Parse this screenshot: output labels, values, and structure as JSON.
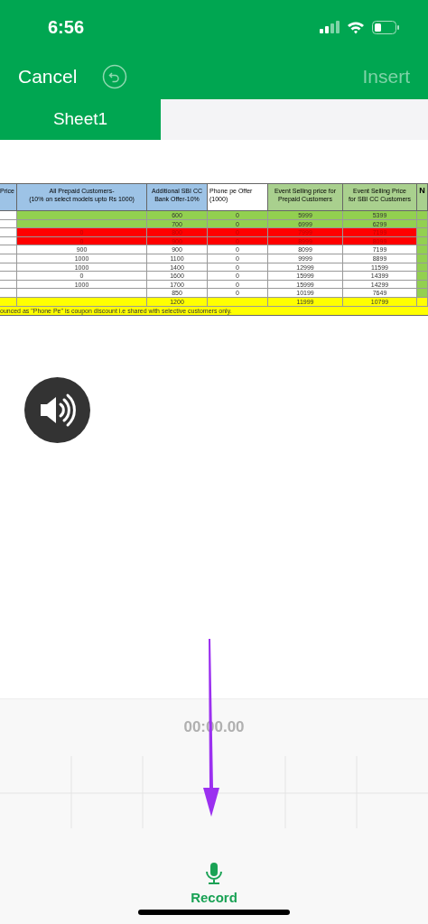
{
  "status_bar": {
    "time": "6:56"
  },
  "nav": {
    "cancel": "Cancel",
    "insert": "Insert",
    "insert_disabled": true
  },
  "tabs": [
    {
      "label": "Sheet1",
      "selected": true
    }
  ],
  "sheet": {
    "columns": [
      {
        "label": "Price",
        "color": "#9dc3e6"
      },
      {
        "label": "All Prepaid Customers-\n(10% on select models upto Rs 1000)",
        "color": "#9dc3e6"
      },
      {
        "label": "Additional SBI CC\nBank Offer-10%",
        "color": "#9dc3e6"
      },
      {
        "label": "Phone pe Offer\n(1000)",
        "color": "#ffffff"
      },
      {
        "label": "Event Selling price for\nPrepaid Customers",
        "color": "#a9d08e"
      },
      {
        "label": "Event Selling Price\nfor SBI CC Customers",
        "color": "#a9d08e"
      },
      {
        "label": "N",
        "color": "#a9d08e"
      }
    ],
    "rows": [
      {
        "kind": "green",
        "cells": [
          "",
          "",
          "600",
          "0",
          "5999",
          "5399",
          ""
        ]
      },
      {
        "kind": "green",
        "cells": [
          "",
          "",
          "700",
          "0",
          "6999",
          "6299",
          ""
        ]
      },
      {
        "kind": "red",
        "cells": [
          "",
          "0",
          "800",
          "0",
          "7999",
          "7199",
          ""
        ]
      },
      {
        "kind": "red",
        "cells": [
          "",
          "0",
          "900",
          "0",
          "8999",
          "8099",
          ""
        ]
      },
      {
        "kind": "white",
        "cells": [
          "",
          "900",
          "900",
          "0",
          "8099",
          "7199",
          ""
        ]
      },
      {
        "kind": "white",
        "cells": [
          "",
          "1000",
          "1100",
          "0",
          "9999",
          "8899",
          ""
        ]
      },
      {
        "kind": "white",
        "cells": [
          "",
          "1000",
          "1400",
          "0",
          "12999",
          "11599",
          ""
        ]
      },
      {
        "kind": "white",
        "cells": [
          "",
          "0",
          "1600",
          "0",
          "15999",
          "14399",
          ""
        ]
      },
      {
        "kind": "white",
        "cells": [
          "",
          "1000",
          "1700",
          "0",
          "15999",
          "14299",
          ""
        ]
      },
      {
        "kind": "white",
        "cells": [
          "",
          "",
          "850",
          "0",
          "10199",
          "7649",
          ""
        ]
      },
      {
        "kind": "yellow",
        "cells": [
          "",
          "",
          "1200",
          "",
          "11999",
          "10799",
          ""
        ]
      }
    ],
    "note": "ounced as \"Phone Pe\" is coupon discount i.e shared with selective customers only."
  },
  "recorder": {
    "timer": "00:00.00",
    "record": "Record"
  }
}
